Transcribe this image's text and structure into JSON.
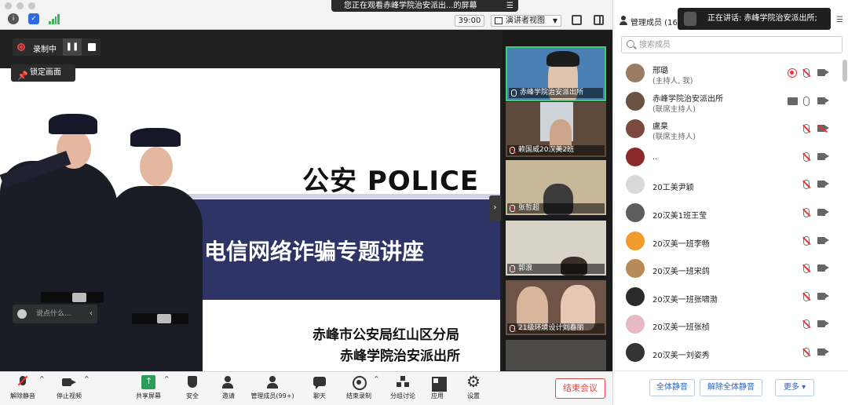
{
  "topbar": {
    "share_banner": "您正在观看赤峰学院治安派出...的屏幕",
    "timer": "39:00",
    "view_mode": "演讲者视图"
  },
  "stage": {
    "recording_label": "录制中",
    "pin_label": "锁定画面",
    "chat_placeholder": "说点什么..."
  },
  "slide": {
    "title": "公安 POLICE",
    "subtitle": "电信网络诈骗专题讲座",
    "org_line1": "赤峰市公安局红山区分局",
    "org_line2": "赤峰学院治安派出所"
  },
  "video_tiles": [
    {
      "name": "赤峰学院治安派出所",
      "muted": false,
      "active": true
    },
    {
      "name": "赖国威20汉美2班",
      "muted": true,
      "active": false
    },
    {
      "name": "张哲超",
      "muted": true,
      "active": false
    },
    {
      "name": "郭浪",
      "muted": true,
      "active": false
    },
    {
      "name": "21级环境设计刘春丽",
      "muted": true,
      "active": false
    },
    {
      "name": "",
      "muted": true,
      "active": false
    }
  ],
  "toolbar": {
    "unmute": "解除静音",
    "stop_video": "停止视频",
    "share_screen": "共享屏幕",
    "security": "安全",
    "invite": "邀请",
    "manage_members": "管理成员(99+)",
    "chat": "聊天",
    "end_recording": "结束录制",
    "breakout": "分组讨论",
    "apps": "应用",
    "settings": "设置",
    "end_meeting": "结束会议"
  },
  "panel": {
    "title": "管理成员 (169",
    "speaking": "正在讲话: 赤峰学院治安派出所;",
    "search_placeholder": "搜索成员",
    "members": [
      {
        "name": "邢璐",
        "role": "(主持人, 我)",
        "avatar_color": "#9a7b63"
      },
      {
        "name": "赤峰学院治安派出所",
        "role": "(联席主持人)",
        "avatar_color": "#6b5343"
      },
      {
        "name": "盧臬",
        "role": "(联席主持人)",
        "avatar_color": "#7b4a3f"
      },
      {
        "name": "..",
        "role": "",
        "avatar_color": "#8a2a2a"
      },
      {
        "name": "20工美尹颖",
        "role": "",
        "avatar_color": "#d9d9d9"
      },
      {
        "name": "20汉美1班王莹",
        "role": "",
        "avatar_color": "#5d5d5d"
      },
      {
        "name": "20汉美一班李畅",
        "role": "",
        "avatar_color": "#f29b2d"
      },
      {
        "name": "20汉美一班宋鸽",
        "role": "",
        "avatar_color": "#b88a5a"
      },
      {
        "name": "20汉美一班张啸渤",
        "role": "",
        "avatar_color": "#2b2b2b"
      },
      {
        "name": "20汉美一班张桢",
        "role": "",
        "avatar_color": "#e7b9c3"
      },
      {
        "name": "20汉美一刘姿秀",
        "role": "",
        "avatar_color": "#333333"
      }
    ],
    "mute_all": "全体静音",
    "unmute_all": "解除全体静音",
    "more": "更多 ▾"
  }
}
